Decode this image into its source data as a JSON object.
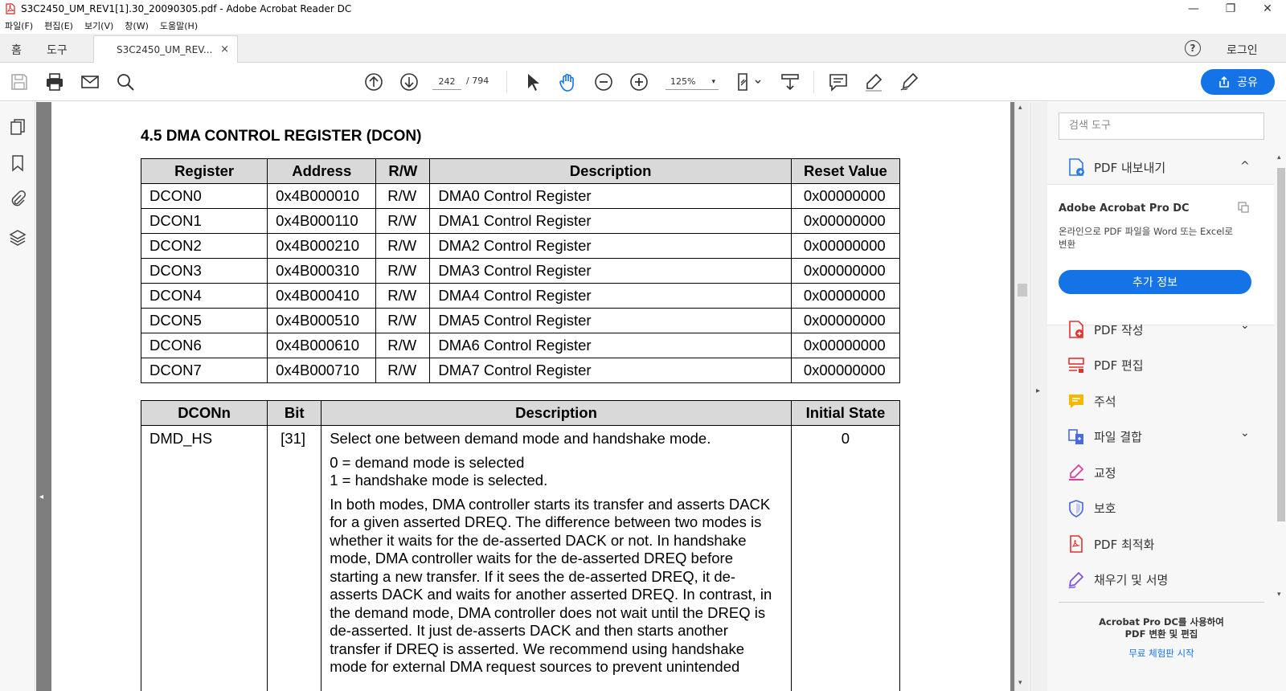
{
  "window": {
    "title": "S3C2450_UM_REV1[1].30_20090305.pdf - Adobe Acrobat Reader DC",
    "controls": {
      "minimize": "—",
      "maximize": "❐",
      "close": "✕"
    }
  },
  "menubar": {
    "items": [
      "파일(F)",
      "편집(E)",
      "보기(V)",
      "창(W)",
      "도움말(H)"
    ]
  },
  "tabs": {
    "home": "홈",
    "tools": "도구",
    "document": "S3C2450_UM_REV...",
    "close": "×",
    "help": "?",
    "login": "로그인"
  },
  "toolbar": {
    "current_page": "242",
    "total_pages": "/ 794",
    "zoom": "125%",
    "zoom_caret": "▾",
    "share_label": "공유",
    "icons": [
      "save-icon",
      "print-icon",
      "email-icon",
      "search-icon",
      "prev-page-icon",
      "next-page-icon",
      "select-cursor-icon",
      "hand-icon",
      "zoom-out-icon",
      "zoom-in-icon",
      "fit-page-icon",
      "scroll-mode-icon",
      "comment-icon",
      "highlight-icon",
      "sign-icon"
    ]
  },
  "leftrail": {
    "icons": [
      "page-thumbnails-icon",
      "bookmark-icon",
      "attachment-icon",
      "layers-icon"
    ],
    "collapse": "◂"
  },
  "document": {
    "section_heading": "4.5 DMA CONTROL REGISTER (DCON)",
    "register_table": {
      "headers": [
        "Register",
        "Address",
        "R/W",
        "Description",
        "Reset Value"
      ],
      "rows": [
        [
          "DCON0",
          "0x4B000010",
          "R/W",
          "DMA0 Control Register",
          "0x00000000"
        ],
        [
          "DCON1",
          "0x4B000110",
          "R/W",
          "DMA1 Control Register",
          "0x00000000"
        ],
        [
          "DCON2",
          "0x4B000210",
          "R/W",
          "DMA2 Control Register",
          "0x00000000"
        ],
        [
          "DCON3",
          "0x4B000310",
          "R/W",
          "DMA3 Control Register",
          "0x00000000"
        ],
        [
          "DCON4",
          "0x4B000410",
          "R/W",
          "DMA4 Control Register",
          "0x00000000"
        ],
        [
          "DCON5",
          "0x4B000510",
          "R/W",
          "DMA5 Control Register",
          "0x00000000"
        ],
        [
          "DCON6",
          "0x4B000610",
          "R/W",
          "DMA6 Control Register",
          "0x00000000"
        ],
        [
          "DCON7",
          "0x4B000710",
          "R/W",
          "DMA7 Control Register",
          "0x00000000"
        ]
      ]
    },
    "bit_table": {
      "headers": [
        "DCONn",
        "Bit",
        "Description",
        "Initial State"
      ],
      "row": {
        "name": "DMD_HS",
        "bit": "[31]",
        "desc_line1": "Select one between demand mode and handshake mode.",
        "desc_line2": "0 = demand mode is selected",
        "desc_line3": "1 = handshake mode is selected.",
        "desc_para": "In both modes, DMA controller starts its transfer and asserts DACK for a given asserted DREQ. The difference between two modes is whether it waits for the de-asserted DACK or not. In handshake mode, DMA controller waits for the de-asserted DREQ before starting a new transfer. If it sees the de-asserted DREQ, it de-asserts DACK and waits for another asserted DREQ. In contrast, in the demand mode, DMA controller does not wait until the DREQ is de-asserted. It just de-asserts DACK and then starts another transfer if DREQ is asserted. We recommend using handshake mode for external DMA request sources to prevent unintended",
        "initial": "0"
      }
    },
    "scroll_up": "▴",
    "scroll_down": "▾",
    "right_collapse": "▸"
  },
  "rightpanel": {
    "search_placeholder": "검색 도구",
    "export_label": "PDF 내보내기",
    "export_chevron": "^",
    "export_product": "Adobe Acrobat Pro DC",
    "export_desc": "온라인으로 PDF 파일을 Word 또는 Excel로 변환",
    "more_info": "추가 정보",
    "tools": [
      {
        "label": "PDF 작성",
        "icon": "create-pdf-icon",
        "chevron": true,
        "color": "#e0332e"
      },
      {
        "label": "PDF 편집",
        "icon": "edit-pdf-icon",
        "chevron": false,
        "color": "#e0332e"
      },
      {
        "label": "주석",
        "icon": "comment-tool-icon",
        "chevron": false,
        "color": "#f5b800"
      },
      {
        "label": "파일 결합",
        "icon": "combine-files-icon",
        "chevron": true,
        "color": "#4b6bdc"
      },
      {
        "label": "교정",
        "icon": "redact-icon",
        "chevron": false,
        "color": "#e03ca0"
      },
      {
        "label": "보호",
        "icon": "protect-icon",
        "chevron": false,
        "color": "#4b6bdc"
      },
      {
        "label": "PDF 최적화",
        "icon": "optimize-pdf-icon",
        "chevron": false,
        "color": "#e0332e"
      },
      {
        "label": "채우기 및 서명",
        "icon": "fill-sign-icon",
        "chevron": false,
        "color": "#7b4fd9"
      }
    ],
    "chevron_down": "⌄",
    "promo_line1": "Acrobat Pro DC를 사용하여",
    "promo_line2": "PDF 변환 및 편집",
    "promo_link": "무료 체험판 시작"
  }
}
